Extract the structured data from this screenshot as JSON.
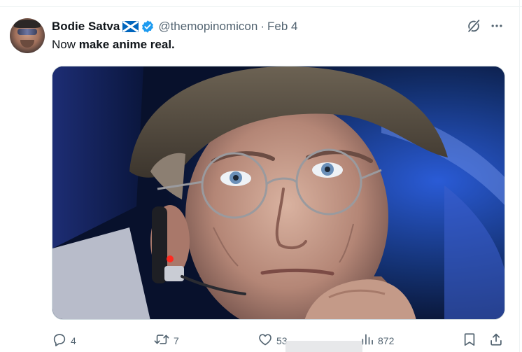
{
  "tweet": {
    "author": {
      "display_name": "Bodie Satva",
      "handle": "@themopinomicon",
      "separator": "·",
      "date": "Feb 4",
      "verified": true,
      "flag": "scotland-flag"
    },
    "text": {
      "prefix": "Now ",
      "bold": "make anime real."
    },
    "media": {
      "kind": "photo"
    },
    "actions": {
      "reply_count": "4",
      "retweet_count": "7",
      "like_count": "53",
      "view_count": "872"
    }
  },
  "colors": {
    "text_primary": "#0f1419",
    "text_secondary": "#536471",
    "verified_blue": "#1d9bf0",
    "scotland_blue": "#0065bd",
    "border": "#cfd9de"
  },
  "icons": {
    "grok": "grok-icon",
    "more": "more-dots-icon",
    "reply": "reply-bubble-icon",
    "retweet": "retweet-icon",
    "like": "heart-icon",
    "views": "bar-chart-icon",
    "bookmark": "bookmark-icon",
    "share": "share-upload-icon"
  }
}
